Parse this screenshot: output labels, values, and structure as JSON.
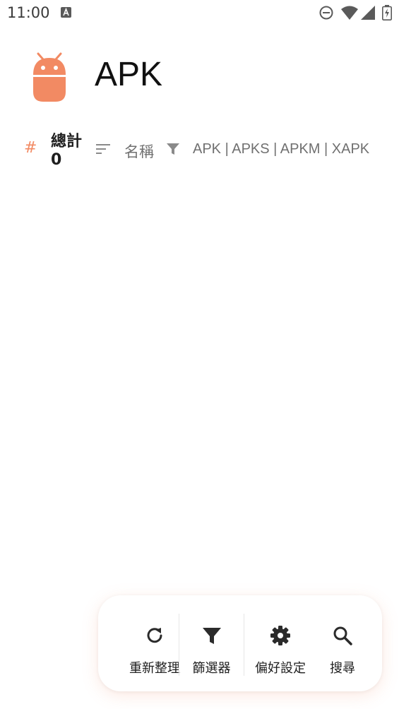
{
  "status_bar": {
    "time": "11:00",
    "icons": [
      "a-notification-icon",
      "do-not-disturb-icon",
      "wifi-icon",
      "cell-signal-icon",
      "battery-charging-icon"
    ]
  },
  "header": {
    "logo_icon": "android-icon",
    "title": "APK"
  },
  "info_row": {
    "total_label": "總計",
    "total_count": "0",
    "sort_label": "名稱",
    "filter_types": "APK | APKS | APKM | XAPK"
  },
  "toolbar": {
    "items": [
      {
        "icon": "refresh-icon",
        "label": "重新整理"
      },
      {
        "icon": "filter-icon",
        "label": "篩選器"
      },
      {
        "icon": "gear-icon",
        "label": "偏好設定"
      },
      {
        "icon": "search-icon",
        "label": "搜尋"
      }
    ]
  },
  "colors": {
    "accent": "#f28a63",
    "text_secondary": "#707070",
    "icon_dark": "#2b2b2b"
  }
}
